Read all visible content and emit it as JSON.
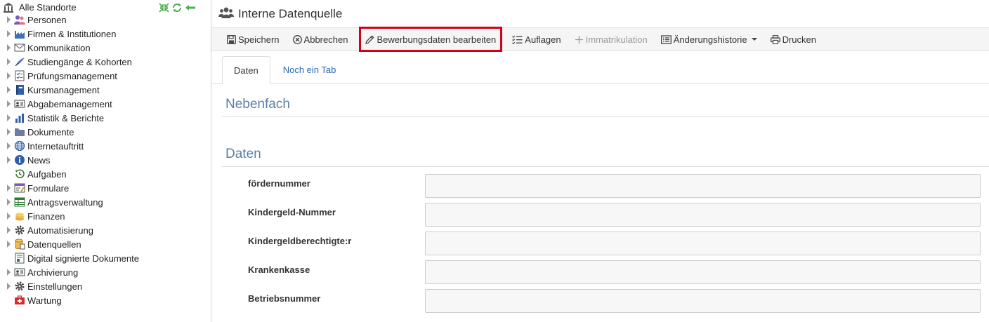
{
  "sidebar": {
    "root_label": "Alle Standorte",
    "items": [
      {
        "label": "Personen",
        "icon": "people-icon",
        "expandable": true
      },
      {
        "label": "Firmen & Institutionen",
        "icon": "factory-icon",
        "expandable": true
      },
      {
        "label": "Kommunikation",
        "icon": "envelope-icon",
        "expandable": true
      },
      {
        "label": "Studiengänge & Kohorten",
        "icon": "quill-icon",
        "expandable": true
      },
      {
        "label": "Prüfungsmanagement",
        "icon": "checklist-icon",
        "expandable": true
      },
      {
        "label": "Kursmanagement",
        "icon": "book-icon",
        "expandable": true
      },
      {
        "label": "Abgabemanagement",
        "icon": "id-card-icon",
        "expandable": true
      },
      {
        "label": "Statistik & Berichte",
        "icon": "bar-chart-icon",
        "expandable": true
      },
      {
        "label": "Dokumente",
        "icon": "folder-icon",
        "expandable": true
      },
      {
        "label": "Internetauftritt",
        "icon": "globe-icon",
        "expandable": true
      },
      {
        "label": "News",
        "icon": "info-icon",
        "expandable": true
      },
      {
        "label": "Aufgaben",
        "icon": "history-icon",
        "expandable": false
      },
      {
        "label": "Formulare",
        "icon": "form-icon",
        "expandable": true
      },
      {
        "label": "Antragsverwaltung",
        "icon": "table-icon",
        "expandable": true
      },
      {
        "label": "Finanzen",
        "icon": "coins-icon",
        "expandable": true
      },
      {
        "label": "Automatisierung",
        "icon": "gear-icon",
        "expandable": true
      },
      {
        "label": "Datenquellen",
        "icon": "database-icon",
        "expandable": true
      },
      {
        "label": "Digital signierte Dokumente",
        "icon": "signed-document-icon",
        "expandable": false
      },
      {
        "label": "Archivierung",
        "icon": "archive-card-icon",
        "expandable": true
      },
      {
        "label": "Einstellungen",
        "icon": "settings-gear-icon",
        "expandable": true
      },
      {
        "label": "Wartung",
        "icon": "first-aid-icon",
        "expandable": false
      }
    ]
  },
  "header": {
    "title": "Interne Datenquelle"
  },
  "toolbar": {
    "save": "Speichern",
    "cancel": "Abbrechen",
    "edit_application": "Bewerbungsdaten bearbeiten",
    "requirements": "Auflagen",
    "enrollment": "Immatrikulation",
    "history": "Änderungshistorie",
    "print": "Drucken"
  },
  "tabs": [
    {
      "label": "Daten",
      "active": true
    },
    {
      "label": "Noch ein Tab",
      "active": false
    }
  ],
  "sections": {
    "minor": "Nebenfach",
    "data": "Daten"
  },
  "fields": [
    {
      "label": "fördernummer",
      "value": ""
    },
    {
      "label": "Kindergeld-Nummer",
      "value": ""
    },
    {
      "label": "Kindergeldberechtigte:r",
      "value": ""
    },
    {
      "label": "Krankenkasse",
      "value": ""
    },
    {
      "label": "Betriebsnummer",
      "value": ""
    }
  ],
  "colors": {
    "accent_red": "#d0021b",
    "section_title": "#5b7fa8",
    "link_blue": "#2a6ab0",
    "toolbar_bg": "#f5f5f5"
  }
}
